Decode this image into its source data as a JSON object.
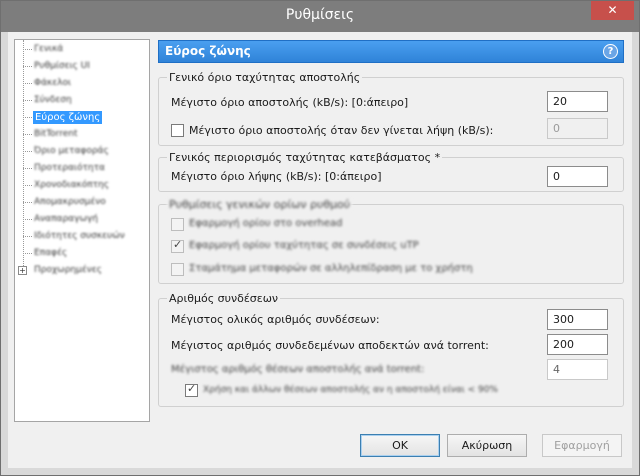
{
  "window": {
    "title": "Ρυθμίσεις",
    "close_glyph": "✕"
  },
  "sidebar": {
    "items": [
      {
        "label": "Γενικά"
      },
      {
        "label": "Ρυθμίσεις UI"
      },
      {
        "label": "Φάκελοι"
      },
      {
        "label": "Σύνδεση"
      },
      {
        "label": "Εύρος ζώνης",
        "selected": true
      },
      {
        "label": "BitTorrent"
      },
      {
        "label": "Όριο μεταφοράς"
      },
      {
        "label": "Προτεραιότητα"
      },
      {
        "label": "Χρονοδιακόπτης"
      },
      {
        "label": "Απομακρυσμένο"
      },
      {
        "label": "Αναπαραγωγή"
      },
      {
        "label": "Ιδιότητες συσκευών"
      },
      {
        "label": "Επαφές"
      },
      {
        "label": "Προχωρημένες",
        "expandable": true
      }
    ]
  },
  "header": {
    "title": "Εύρος ζώνης",
    "help_glyph": "?"
  },
  "upload": {
    "title": "Γενικό όριο ταχύτητας αποστολής",
    "max_label": "Μέγιστο όριο αποστολής (kB/s): [0:άπειρο]",
    "max_value": "20",
    "alt_label": "Μέγιστο όριο αποστολής όταν δεν γίνεται λήψη (kB/s):",
    "alt_value": "0"
  },
  "download": {
    "title": "Γενικός περιορισμός ταχύτητας κατεβάσματος *",
    "max_label": "Μέγιστο όριο λήψης (kB/s): [0:άπειρο]",
    "max_value": "0"
  },
  "global_limits": {
    "title": "Ρυθμίσεις γενικών ορίων ρυθμού",
    "opt1": "Εφαρμογή ορίου στο overhead",
    "opt2": "Εφαρμογή ορίου ταχύτητας σε συνδέσεις uTP",
    "opt3": "Σταμάτημα μεταφορών σε αλληλεπίδραση με το χρήστη"
  },
  "connections": {
    "title": "Αριθμός συνδέσεων",
    "total_label": "Μέγιστος ολικός αριθμός συνδέσεων:",
    "total_value": "300",
    "peers_label": "Μέγιστος αριθμός συνδεδεμένων αποδεκτών ανά torrent:",
    "peers_value": "200",
    "slots_label": "Μέγιστος αριθμός θέσεων αποστολής ανά torrent:",
    "slots_value": "4",
    "extra_label": "Χρήση και άλλων θέσεων αποστολής αν η αποστολή είναι < 90%"
  },
  "buttons": {
    "ok": "OK",
    "cancel": "Ακύρωση",
    "apply": "Εφαρμογή"
  }
}
